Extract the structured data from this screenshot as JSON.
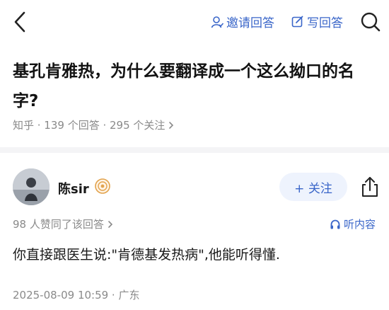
{
  "nav": {
    "invite_label": "邀请回答",
    "write_label": "写回答"
  },
  "question": {
    "title": "基孔肯雅热，为什么要翻译成一个这么拗口的名字?",
    "meta": "知乎 · 139 个回答 · 295 个关注"
  },
  "answer": {
    "author": "陈sir",
    "follow_label": "+ 关注",
    "likes": "98 人赞同了该回答",
    "listen_label": "听内容",
    "text": "你直接跟医生说:\"肯德基发热病\",他能听得懂.",
    "timestamp": "2025-08-09 10:59 · 广东"
  },
  "colors": {
    "accent": "#3a66c9",
    "muted": "#8a8a8a",
    "divider": "#f4f4f6"
  },
  "icons": [
    "back-icon",
    "invite-user-icon",
    "edit-icon",
    "search-icon",
    "badge-icon",
    "share-icon",
    "headphones-icon",
    "chevron-right-icon"
  ]
}
